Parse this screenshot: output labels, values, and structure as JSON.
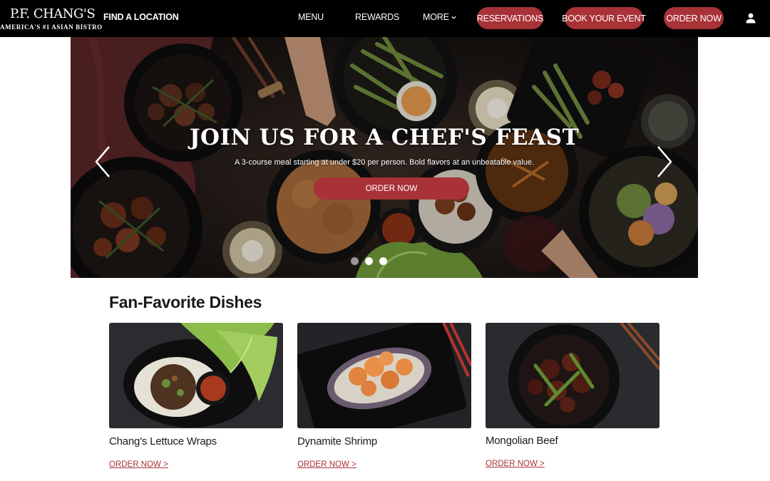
{
  "brand": {
    "name": "P.F. CHANG'S",
    "tagline": "AMERICA'S #1 ASIAN BISTRO"
  },
  "nav": {
    "find_location": "FIND A LOCATION",
    "menu": "MENU",
    "rewards": "REWARDS",
    "more": "MORE",
    "reservations": "RESERVATIONS",
    "book_event": "BOOK YOUR EVENT",
    "order_now": "ORDER NOW",
    "account_icon": "user-icon"
  },
  "hero": {
    "title": "JOIN US FOR A CHEF'S FEAST",
    "subtitle": "A 3-course meal starting at under $20 per person. Bold flavors at an unbeatable value.",
    "cta": "ORDER NOW",
    "prev_icon": "chevron-left-icon",
    "next_icon": "chevron-right-icon",
    "slide_count": 3
  },
  "favorites": {
    "title": "Fan-Favorite Dishes",
    "items": [
      {
        "name": "Chang's Lettuce Wraps",
        "link": "ORDER NOW >"
      },
      {
        "name": "Dynamite Shrimp",
        "link": "ORDER NOW >"
      },
      {
        "name": "Mongolian Beef",
        "link": "ORDER NOW >"
      }
    ]
  },
  "colors": {
    "brand_red": "#a83237",
    "nav_bg": "#000000",
    "text": "#1a1a1a"
  }
}
